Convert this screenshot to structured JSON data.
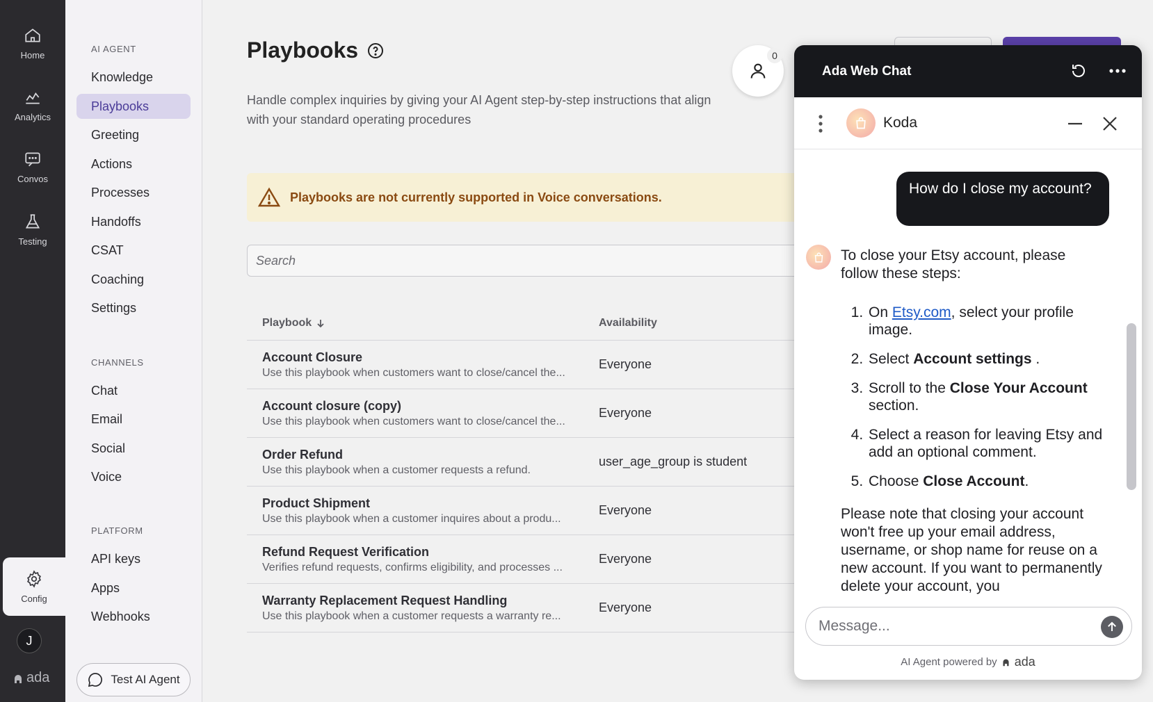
{
  "rail": {
    "items": [
      {
        "label": "Home",
        "icon": "home-icon"
      },
      {
        "label": "Analytics",
        "icon": "analytics-icon"
      },
      {
        "label": "Convos",
        "icon": "chat-icon"
      },
      {
        "label": "Testing",
        "icon": "flask-icon"
      }
    ],
    "config_label": "Config",
    "avatar_initial": "J",
    "logo_text": "ada"
  },
  "subnav": {
    "sections": [
      {
        "title": "AI AGENT",
        "items": [
          "Knowledge",
          "Playbooks",
          "Greeting",
          "Actions",
          "Processes",
          "Handoffs",
          "CSAT",
          "Coaching",
          "Settings"
        ]
      },
      {
        "title": "CHANNELS",
        "items": [
          "Chat",
          "Email",
          "Social",
          "Voice"
        ]
      },
      {
        "title": "PLATFORM",
        "items": [
          "API keys",
          "Apps",
          "Webhooks"
        ]
      }
    ],
    "active": "Playbooks",
    "test_button": "Test AI Agent"
  },
  "main": {
    "title": "Playbooks",
    "description": "Handle complex inquiries by giving your AI Agent step-by-step instructions that align with your standard operating procedures",
    "warning": "Playbooks are not currently supported in Voice conversations.",
    "search_placeholder": "Search",
    "columns": [
      "Playbook",
      "Availability"
    ],
    "rows": [
      {
        "name": "Account Closure",
        "desc": "Use this playbook when customers want to close/cancel the...",
        "availability": "Everyone"
      },
      {
        "name": "Account closure (copy)",
        "desc": "Use this playbook when customers want to close/cancel the...",
        "availability": "Everyone"
      },
      {
        "name": "Order Refund",
        "desc": "Use this playbook when a customer requests a refund.",
        "availability": "user_age_group is student"
      },
      {
        "name": "Product Shipment",
        "desc": "Use this playbook when a customer inquires about a produ...",
        "availability": "Everyone"
      },
      {
        "name": "Refund Request Verification",
        "desc": "Verifies refund requests, confirms eligibility, and processes ...",
        "availability": "Everyone"
      },
      {
        "name": "Warranty Replacement Request Handling",
        "desc": "Use this playbook when a customer requests a warranty re...",
        "availability": "Everyone"
      }
    ]
  },
  "launcher": {
    "badge": "0"
  },
  "chat": {
    "window_title": "Ada Web Chat",
    "bot_name": "Koda",
    "user_message": "How do I close my account?",
    "bot_intro": "To close your Etsy account, please follow these steps:",
    "steps": {
      "s1_pre": "On ",
      "s1_link": "Etsy.com",
      "s1_post": ", select your profile image.",
      "s2_pre": "Select ",
      "s2_bold": "Account settings",
      "s2_post": " .",
      "s3_pre": "Scroll to the ",
      "s3_bold": "Close Your Account",
      "s3_post": " section.",
      "s4": "Select a reason for leaving Etsy and add an optional comment.",
      "s5_pre": "Choose ",
      "s5_bold": "Close Account",
      "s5_post": "."
    },
    "note": "Please note that closing your account won't free up your email address, username, or shop name for reuse on a new account. If you want to permanently delete your account, you",
    "input_placeholder": "Message...",
    "powered_by": "AI Agent powered by",
    "powered_brand": "ada"
  }
}
